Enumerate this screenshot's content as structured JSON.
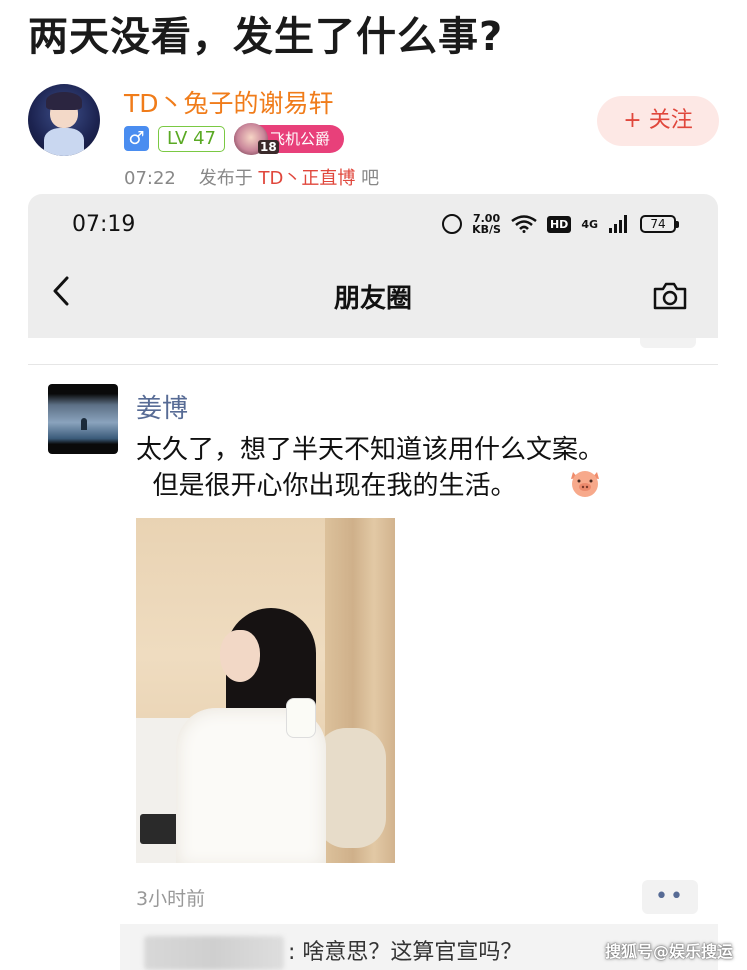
{
  "post": {
    "title": "两天没看，发生了什么事?"
  },
  "author": {
    "name": "TD丶兔子的谢易轩",
    "gender_symbol": "♂",
    "level": "LV 47",
    "title_badge": "飞机公爵",
    "title_badge_level": "18",
    "time": "07:22",
    "posted_in_label": "发布于",
    "bar_name": "TD丶正直博",
    "bar_suffix": "吧"
  },
  "follow": {
    "label": "+ 关注"
  },
  "screenshot": {
    "status": {
      "time": "07:19",
      "speed_value": "7.00",
      "speed_unit": "KB/S",
      "hd": "HD",
      "network": "4G",
      "battery": "74"
    },
    "nav": {
      "title": "朋友圈"
    },
    "moment": {
      "friend_name": "姜博",
      "text_line1": "太久了，想了半天不知道该用什么文案。",
      "text_line2": "  但是很开心你出现在我的生活。",
      "time_ago": "3小时前",
      "more": "••"
    },
    "comment": {
      "text": ": 啥意思？这算官宣吗？"
    }
  },
  "watermark": "搜狐号@娱乐搜运",
  "colors": {
    "accent_orange": "#f07c1a",
    "follow_red": "#e0473c",
    "wechat_name_blue": "#576b95",
    "level_green": "#7ac943",
    "badge_pink": "#e8407a"
  },
  "icons": [
    "alarm-icon",
    "wifi-icon",
    "signal-icon",
    "battery-icon",
    "back-icon",
    "camera-icon",
    "pig-emoji-icon"
  ]
}
